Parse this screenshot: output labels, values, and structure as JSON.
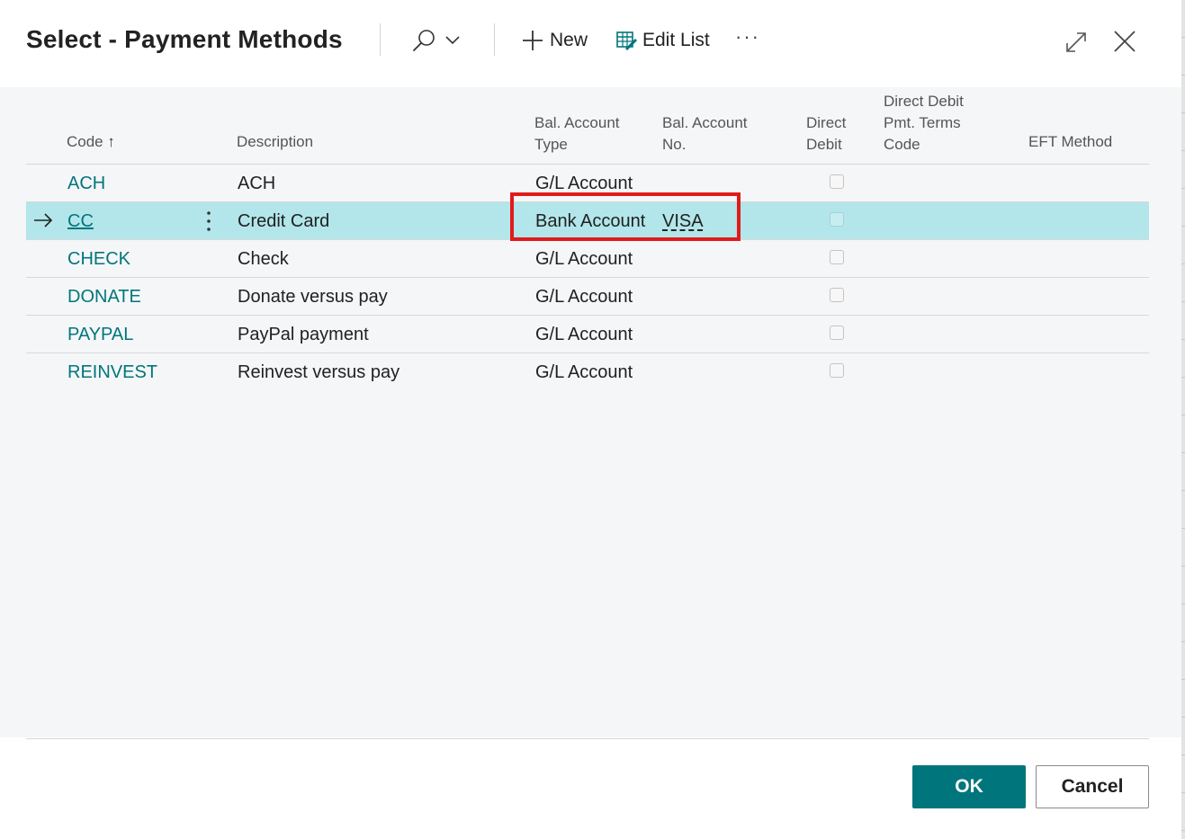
{
  "dialog": {
    "title": "Select - Payment Methods",
    "toolbar": {
      "new_label": "New",
      "edit_list_label": "Edit List",
      "more_label": "···"
    },
    "icons": {
      "search": "search-icon",
      "chevron": "chevron-down-icon",
      "add": "plus-icon",
      "edit_list": "edit-list-icon",
      "expand": "expand-icon",
      "close": "close-icon"
    }
  },
  "table": {
    "headers": {
      "code": "Code",
      "code_sort_glyph": "↑",
      "description": "Description",
      "bal_type_l1": "Bal. Account",
      "bal_type_l2": "Type",
      "bal_no_l1": "Bal. Account",
      "bal_no_l2": "No.",
      "direct_l1": "Direct",
      "direct_l2": "Debit",
      "ddterms_l1": "Direct Debit",
      "ddterms_l2": "Pmt. Terms",
      "ddterms_l3": "Code",
      "eft": "EFT Method"
    },
    "rows": [
      {
        "code": "ACH",
        "description": "ACH",
        "bal_type": "G/L Account",
        "bal_no": "",
        "direct_debit": false,
        "selected": false
      },
      {
        "code": "CC",
        "description": "Credit Card",
        "bal_type": "Bank Account",
        "bal_no": "VISA",
        "direct_debit": false,
        "selected": true
      },
      {
        "code": "CHECK",
        "description": "Check",
        "bal_type": "G/L Account",
        "bal_no": "",
        "direct_debit": false,
        "selected": false
      },
      {
        "code": "DONATE",
        "description": "Donate versus pay",
        "bal_type": "G/L Account",
        "bal_no": "",
        "direct_debit": false,
        "selected": false
      },
      {
        "code": "PAYPAL",
        "description": "PayPal payment",
        "bal_type": "G/L Account",
        "bal_no": "",
        "direct_debit": false,
        "selected": false
      },
      {
        "code": "REINVEST",
        "description": "Reinvest versus pay",
        "bal_type": "G/L Account",
        "bal_no": "",
        "direct_debit": false,
        "selected": false
      }
    ]
  },
  "footer": {
    "ok_label": "OK",
    "cancel_label": "Cancel"
  },
  "colors": {
    "accent": "#00767c",
    "selected_row": "#b2e6ea",
    "highlight": "#e01b1b"
  }
}
